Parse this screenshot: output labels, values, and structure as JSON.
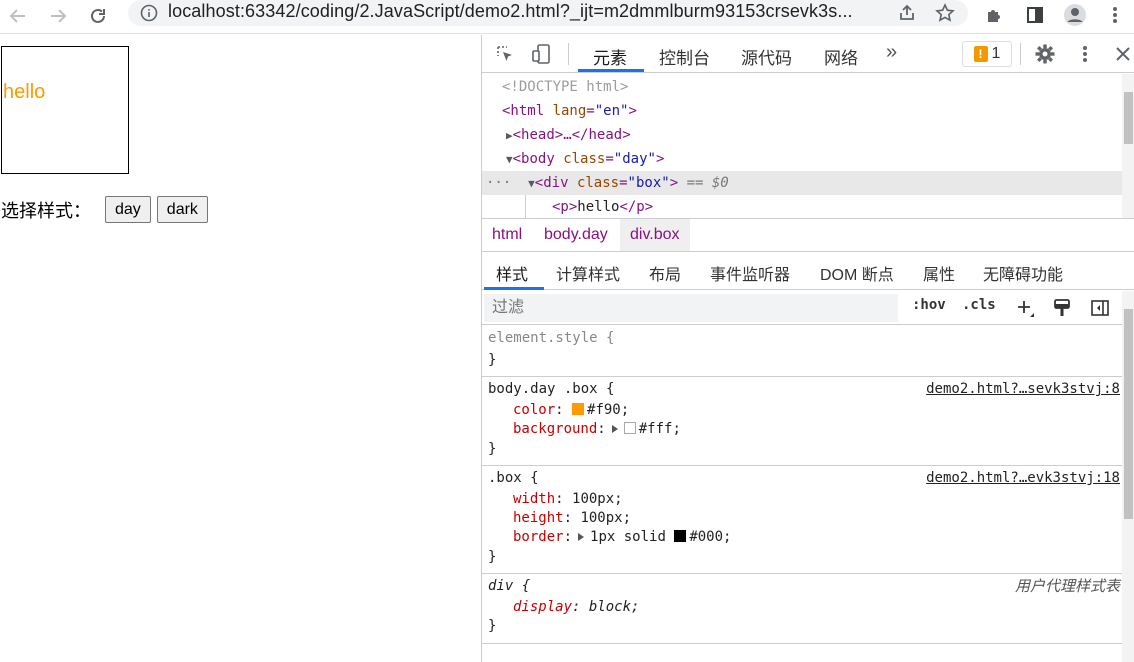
{
  "browser": {
    "url": "localhost:63342/coding/2.JavaScript/demo2.html?_ijt=m2dmmlburm93153crsevk3s..."
  },
  "page": {
    "box_text": "hello",
    "chooser_label": "选择样式：",
    "btn_day": "day",
    "btn_dark": "dark"
  },
  "devtools": {
    "tabs": [
      "元素",
      "控制台",
      "源代码",
      "网络"
    ],
    "more": "»",
    "issues_count": "1",
    "tree": {
      "doctype": "<!DOCTYPE html>",
      "html_open": "<html ",
      "html_attr": "lang",
      "html_val": "\"en\"",
      "head": "<head>…</head>",
      "body_tag": "<body ",
      "body_attr": "class",
      "body_val": "\"day\"",
      "div_tag": "<div ",
      "div_attr": "class",
      "div_val": "\"box\"",
      "div_suffix": "== $0",
      "p_open": "<p>",
      "p_text": "hello",
      "p_close": "</p>"
    },
    "crumbs": [
      "html",
      "body.day",
      "div.box"
    ],
    "subtabs": [
      "样式",
      "计算样式",
      "布局",
      "事件监听器",
      "DOM 断点",
      "属性",
      "无障碍功能"
    ],
    "filter_placeholder": "过滤",
    "hov": ":hov",
    "cls": ".cls",
    "rules": {
      "element_style": "element.style {",
      "close": "}",
      "r1_selector": "body.day .box {",
      "r1_src": "demo2.html?…sevk3stvj:8",
      "r1_p1_name": "color",
      "r1_p1_val": "#f90;",
      "r1_p1_color": "#ff9900",
      "r1_p2_name": "background",
      "r1_p2_val": "#fff;",
      "r1_p2_color": "#ffffff",
      "r2_selector": ".box {",
      "r2_src": "demo2.html?…evk3stvj:18",
      "r2_p1_name": "width",
      "r2_p1_val": "100px;",
      "r2_p2_name": "height",
      "r2_p2_val": "100px;",
      "r2_p3_name": "border",
      "r2_p3_val": "1px solid",
      "r2_p3_color_val": "#000;",
      "r2_p3_color": "#000000",
      "r3_selector": "div {",
      "r3_src": "用户代理样式表",
      "r3_p1_name": "display",
      "r3_p1_val": "block;"
    }
  }
}
